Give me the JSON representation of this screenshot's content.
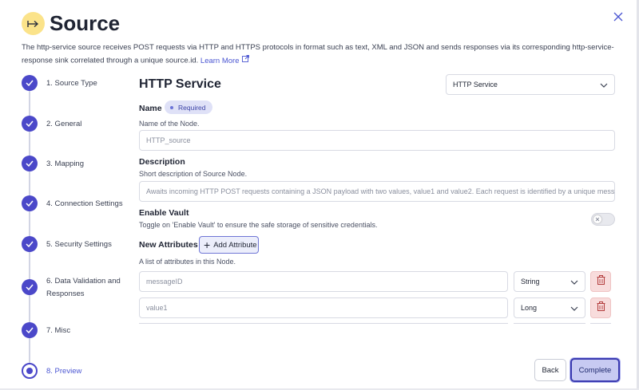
{
  "header": {
    "title": "Source",
    "icon": "arrow-to-line-icon",
    "icon_bg": "#fbe38a",
    "description": "The http-service source receives POST requests via HTTP and HTTPS protocols in format such as text, XML and JSON and sends responses via its corresponding http-service-response sink correlated through a unique source.id.",
    "learn_more": "Learn More"
  },
  "steps": [
    {
      "label": "1. Source Type",
      "status": "done"
    },
    {
      "label": "2. General",
      "status": "done"
    },
    {
      "label": "3. Mapping",
      "status": "done"
    },
    {
      "label": "4. Connection Settings",
      "status": "done"
    },
    {
      "label": "5. Security Settings",
      "status": "done"
    },
    {
      "label": "6. Data Validation and Responses",
      "status": "done"
    },
    {
      "label": "7. Misc",
      "status": "done"
    },
    {
      "label": "8. Preview",
      "status": "current"
    }
  ],
  "form": {
    "section_title": "HTTP Service",
    "type_select": "HTTP Service",
    "name": {
      "label": "Name",
      "badge": "Required",
      "helper": "Name of the Node.",
      "value": "HTTP_source"
    },
    "description": {
      "label": "Description",
      "helper": "Short description of Source Node.",
      "value": "Awaits incoming HTTP POST requests containing a JSON payload with two values, value1 and value2. Each request is identified by a unique messageId, e"
    },
    "vault": {
      "label": "Enable Vault",
      "helper": "Toggle on 'Enable Vault' to ensure the safe storage of sensitive credentials.",
      "enabled": false
    },
    "attributes": {
      "label": "New Attributes",
      "add_button": "Add Attribute",
      "helper": "A list of attributes in this Node.",
      "rows": [
        {
          "name": "messageID",
          "type": "String"
        },
        {
          "name": "value1",
          "type": "Long"
        }
      ]
    }
  },
  "footer": {
    "back": "Back",
    "complete": "Complete"
  },
  "colors": {
    "accent": "#4b48c9",
    "link": "#4b56d2",
    "delete_bg": "#f8dcdc",
    "complete_bg": "#c7caf2"
  }
}
